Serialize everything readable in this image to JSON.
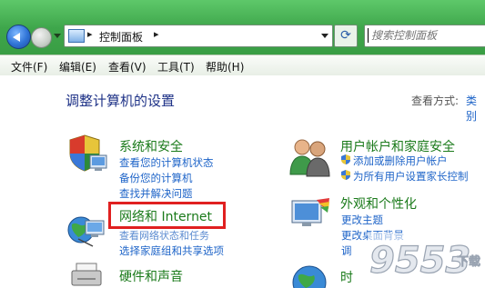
{
  "address_bar": {
    "path": "控制面板",
    "separator": "▸"
  },
  "search": {
    "placeholder": "搜索控制面板"
  },
  "menu": [
    "文件(F)",
    "编辑(E)",
    "查看(V)",
    "工具(T)",
    "帮助(H)"
  ],
  "main": {
    "title": "调整计算机的设置",
    "view_by_label": "查看方式:",
    "view_by_value": "类别"
  },
  "categories": [
    {
      "title": "系统和安全",
      "links": [
        "查看您的计算机状态",
        "备份您的计算机",
        "查找并解决问题"
      ]
    },
    {
      "title": "网络和 Internet",
      "links": [
        "查看网络状态和任务",
        "选择家庭组和共享选项"
      ]
    },
    {
      "title": "硬件和声音",
      "links": []
    },
    {
      "title": "用户帐户和家庭安全",
      "links": [
        "添加或删除用户帐户",
        "为所有用户设置家长控制"
      ]
    },
    {
      "title": "外观和个性化",
      "links": [
        "更改主题",
        "更改桌面背景",
        "调"
      ]
    },
    {
      "title": "时",
      "links": []
    }
  ],
  "watermark": {
    "text": "9553",
    "sub": "下载"
  },
  "colors": {
    "chrome_green": "#3ea64b",
    "category_green": "#1a7a1a",
    "link_blue": "#1e64c8",
    "title_blue": "#1e3287",
    "highlight_red": "#e02020"
  }
}
